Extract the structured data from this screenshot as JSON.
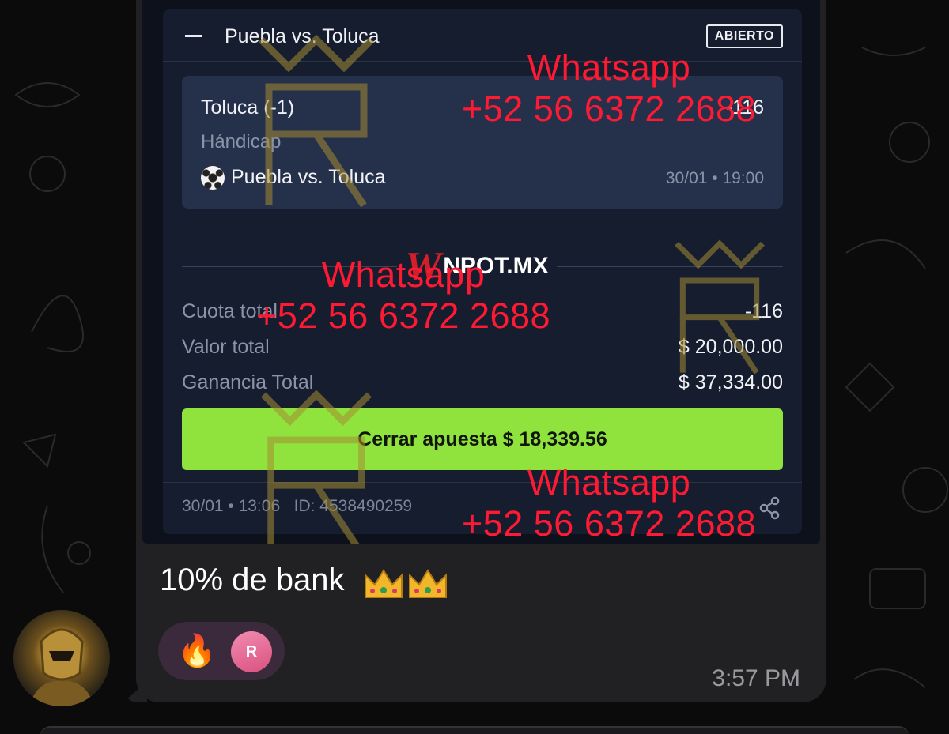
{
  "screenshot": {
    "header": {
      "title": "Puebla vs. Toluca",
      "status_badge": "ABIERTO"
    },
    "selection": {
      "name": "Toluca (-1)",
      "odds": "-116",
      "market": "Hándicap",
      "event": "Puebla vs. Toluca",
      "datetime": "30/01 • 19:00"
    },
    "brand": {
      "logo_w": "W",
      "logo_text": "NPOT.MX"
    },
    "summary": [
      {
        "label": "Cuota total",
        "value": "-116"
      },
      {
        "label": "Valor total",
        "value": "$ 20,000.00"
      },
      {
        "label": "Ganancia Total",
        "value": "$ 37,334.00"
      }
    ],
    "cashout_label": "Cerrar apuesta $ 18,339.56",
    "footer": {
      "date_time": "30/01 • 13:06",
      "bet_id": "ID: 4538490259"
    },
    "watermark": {
      "line1": "Whatsapp",
      "line2": "+52 56 6372 2688"
    }
  },
  "message": {
    "text": "10% de bank",
    "emoji": "👑👑",
    "reaction_emoji": "🔥",
    "reactor_initial": "R",
    "time": "3:57 PM"
  },
  "colors": {
    "accent_green": "#8fe33c",
    "watermark_red": "#ff1a33",
    "card_bg": "#161d2e",
    "bubble_bg": "#212023"
  }
}
